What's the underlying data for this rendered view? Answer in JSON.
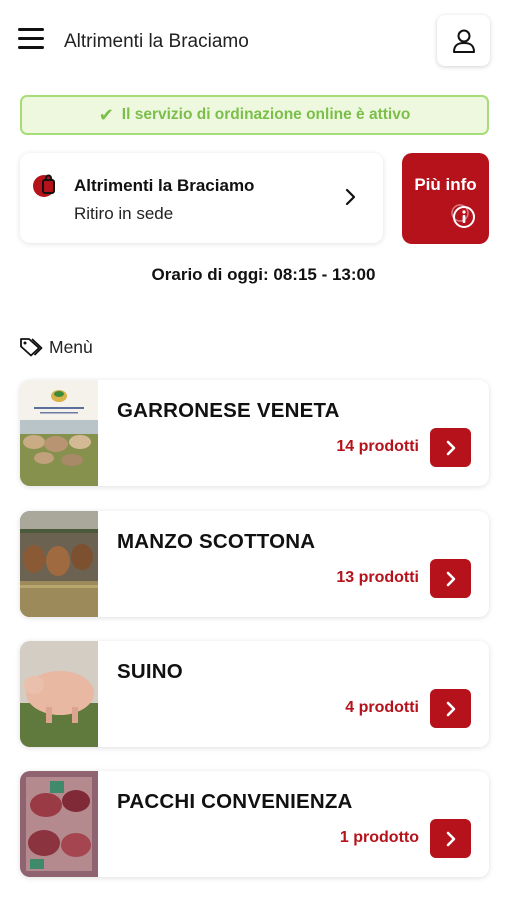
{
  "header": {
    "title": "Altrimenti la Braciamo",
    "menu_icon": "hamburger-icon",
    "user_icon": "user-icon"
  },
  "banner": {
    "icon": "check-icon",
    "text": "Il servizio di ordinazione online è attivo"
  },
  "store": {
    "name": "Altrimenti la Braciamo",
    "mode": "Ritiro in sede",
    "icon": "shopping-bag-icon"
  },
  "info_button": {
    "label": "Più info",
    "icon": "info-icon"
  },
  "hours": {
    "text": "Orario di oggi: 08:15 - 13:00"
  },
  "menu": {
    "heading": "Menù",
    "icon": "tags-icon",
    "categories": [
      {
        "title": "GARRONESE VENETA",
        "count": "14 prodotti"
      },
      {
        "title": "MANZO SCOTTONA",
        "count": "13 prodotti"
      },
      {
        "title": "SUINO",
        "count": "4 prodotti"
      },
      {
        "title": "PACCHI CONVENIENZA",
        "count": "1 prodotto"
      }
    ]
  },
  "colors": {
    "brand_red": "#b5121b",
    "success_green": "#7bbf4a",
    "success_bg": "#eef8df"
  }
}
